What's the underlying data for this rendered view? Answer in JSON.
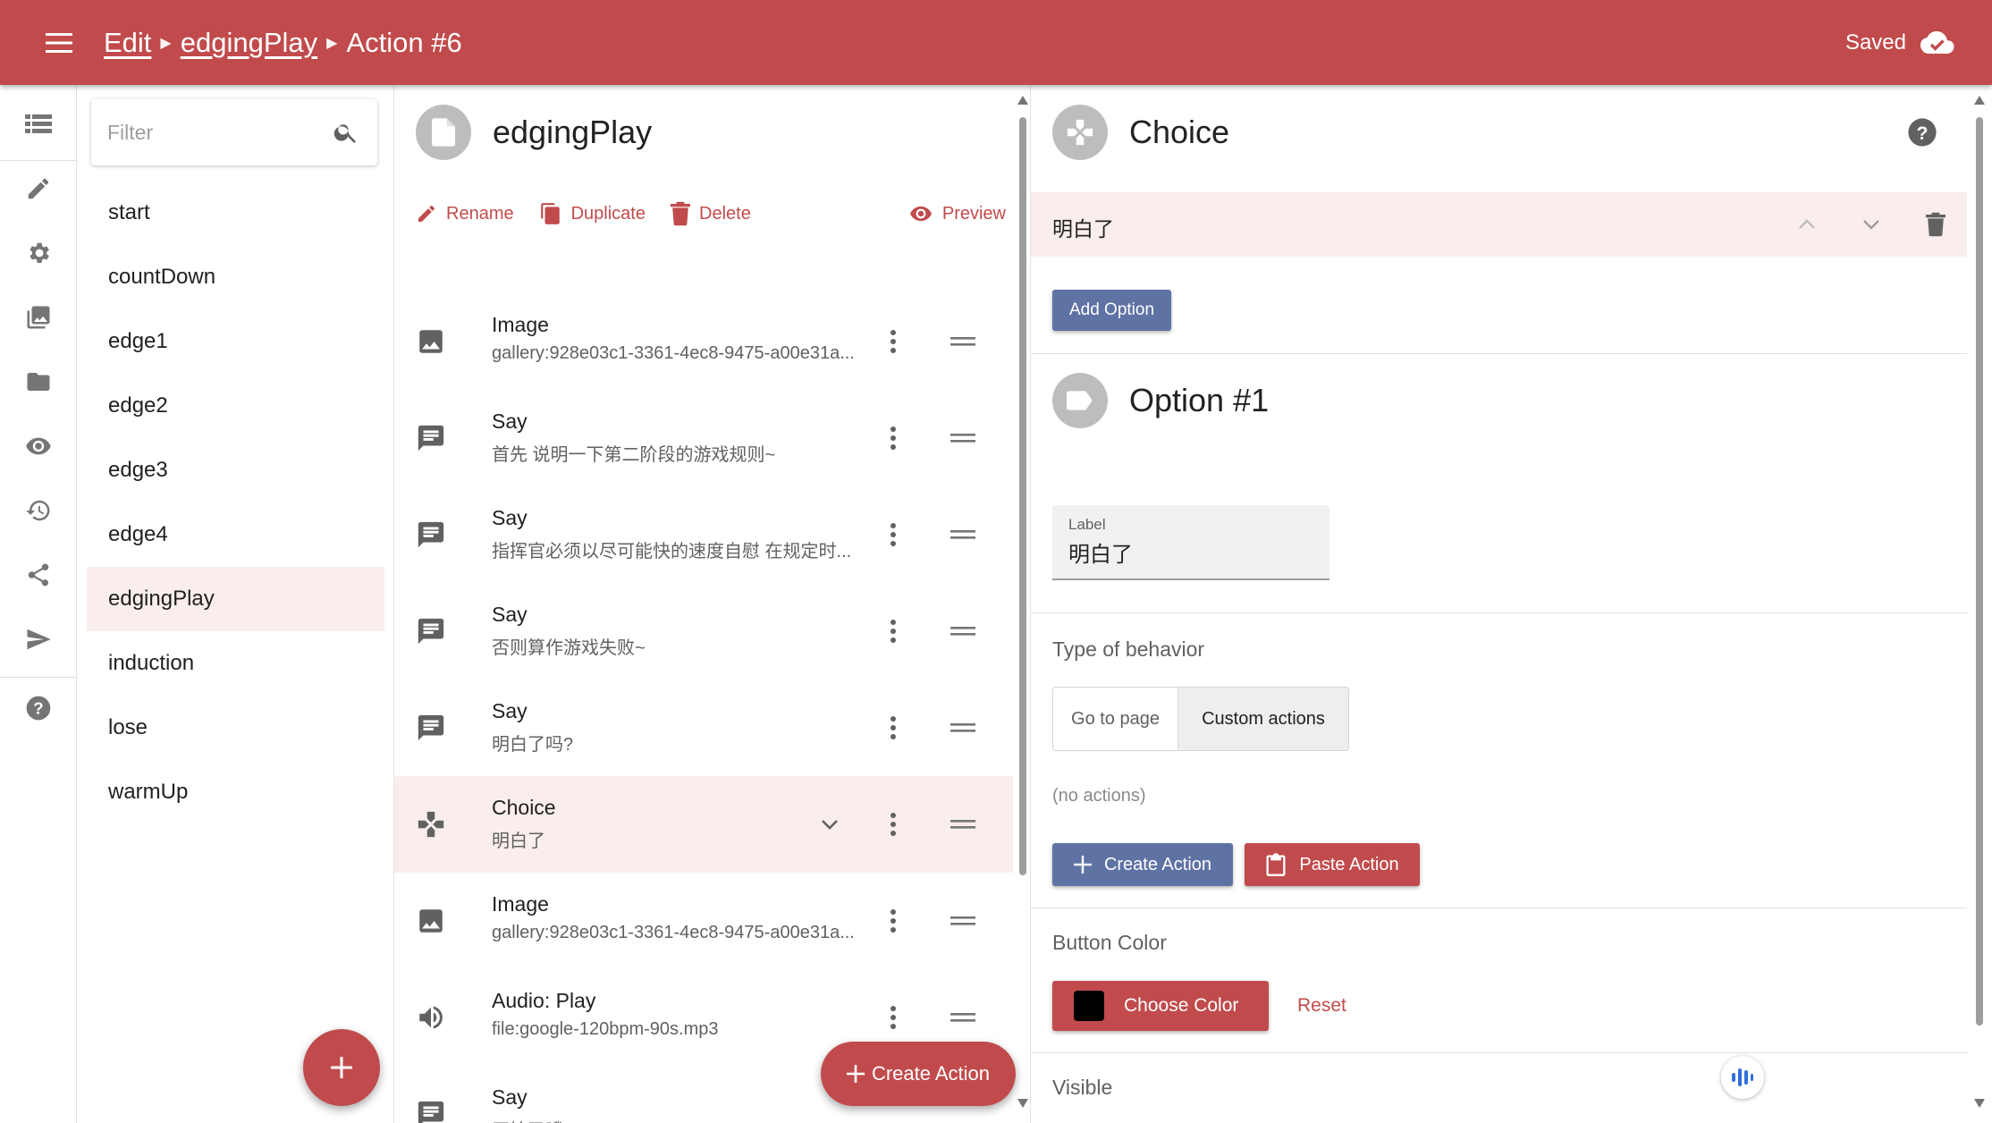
{
  "appbar": {
    "breadcrumb": [
      "Edit",
      "edgingPlay"
    ],
    "current": "Action #6",
    "status": "Saved",
    "menu_icon": "menu-icon",
    "status_icon": "cloud-done-icon",
    "color": "#c14b4c"
  },
  "rail": {
    "icons": [
      "list-icon",
      "pencil-icon",
      "gear-icon",
      "gallery-icon",
      "folder-icon",
      "eye-icon",
      "history-icon",
      "share-icon",
      "send-icon",
      "help-icon"
    ]
  },
  "pages": {
    "filter_placeholder": "Filter",
    "items": [
      "start",
      "countDown",
      "edge1",
      "edge2",
      "edge3",
      "edge4",
      "edgingPlay",
      "induction",
      "lose",
      "warmUp"
    ],
    "active": "edgingPlay",
    "fab_icon": "plus-icon"
  },
  "actions_panel": {
    "title": "edgingPlay",
    "toolbar": {
      "rename": "Rename",
      "duplicate": "Duplicate",
      "delete": "Delete",
      "preview": "Preview"
    },
    "actions": [
      {
        "icon": "image-icon",
        "title": "Image",
        "subtitle": "gallery:928e03c1-3361-4ec8-9475-a00e31a..."
      },
      {
        "icon": "message-icon",
        "title": "Say",
        "subtitle": "首先 说明一下第二阶段的游戏规则~"
      },
      {
        "icon": "message-icon",
        "title": "Say",
        "subtitle": "指挥官必须以尽可能快的速度自慰 在规定时..."
      },
      {
        "icon": "message-icon",
        "title": "Say",
        "subtitle": "否则算作游戏失败~"
      },
      {
        "icon": "message-icon",
        "title": "Say",
        "subtitle": "明白了吗?"
      },
      {
        "icon": "gamepad-icon",
        "title": "Choice",
        "subtitle": "明白了"
      },
      {
        "icon": "image-icon",
        "title": "Image",
        "subtitle": "gallery:928e03c1-3361-4ec8-9475-a00e31a..."
      },
      {
        "icon": "speaker-icon",
        "title": "Audio: Play",
        "subtitle": "file:google-120bpm-90s.mp3"
      },
      {
        "icon": "message-icon",
        "title": "Say",
        "subtitle": "开始了哦~"
      }
    ],
    "selected_index": 5,
    "create_action": "Create Action"
  },
  "detail": {
    "title": "Choice",
    "options": [
      {
        "label": "明白了"
      }
    ],
    "add_option": "Add Option",
    "option_title": "Option #1",
    "label_field": {
      "label": "Label",
      "value": "明白了"
    },
    "behavior": {
      "heading": "Type of behavior",
      "options": [
        "Go to page",
        "Custom actions"
      ],
      "selected": "Custom actions"
    },
    "no_actions": "(no actions)",
    "create_action": "Create Action",
    "paste_action": "Paste Action",
    "button_color": {
      "heading": "Button Color",
      "choose": "Choose Color",
      "reset": "Reset",
      "value": "#000000"
    },
    "visible_heading": "Visible"
  }
}
